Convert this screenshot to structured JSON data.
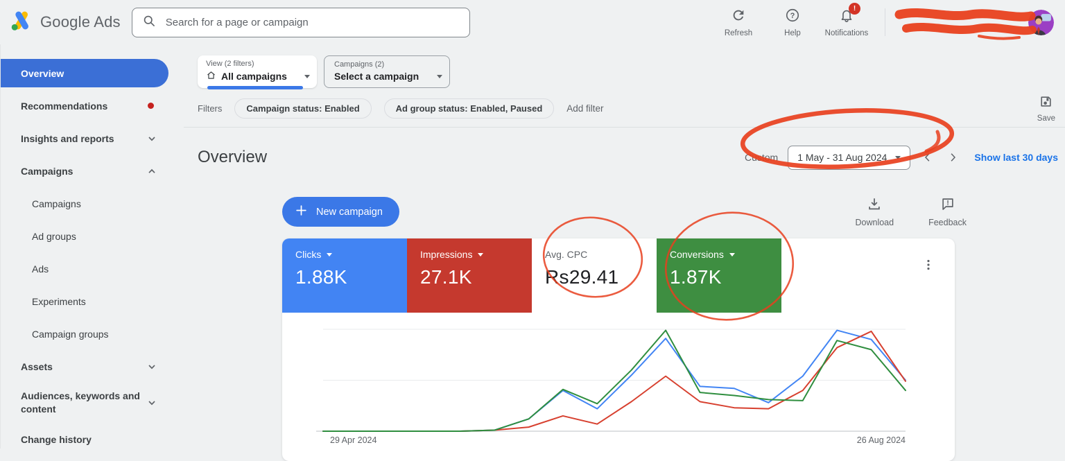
{
  "topbar": {
    "brand": "Google Ads",
    "search": {
      "placeholder": "Search for a page or campaign"
    },
    "refresh_label": "Refresh",
    "help_label": "Help",
    "notifications_label": "Notifications",
    "notification_badge": "!"
  },
  "sidebar": {
    "items": [
      {
        "label": "Overview",
        "selected": true
      },
      {
        "label": "Recommendations",
        "alert_dot": true
      },
      {
        "label": "Insights and reports",
        "chevron": "down"
      },
      {
        "label": "Campaigns",
        "chevron": "up",
        "expanded": true
      },
      {
        "label": "Campaigns",
        "indent": true
      },
      {
        "label": "Ad groups",
        "indent": true
      },
      {
        "label": "Ads",
        "indent": true
      },
      {
        "label": "Experiments",
        "indent": true
      },
      {
        "label": "Campaign groups",
        "indent": true
      },
      {
        "label": "Assets",
        "chevron": "down"
      },
      {
        "label": "Audiences, keywords and content",
        "chevron": "down"
      },
      {
        "label": "Change history"
      }
    ]
  },
  "toolbar": {
    "view_selector": {
      "label": "View (2 filters)",
      "value": "All campaigns"
    },
    "campaign_selector": {
      "label": "Campaigns (2)",
      "value": "Select a campaign"
    },
    "filters_label": "Filters",
    "filter_chips": [
      "Campaign status: Enabled",
      "Ad group status: Enabled, Paused"
    ],
    "add_filter_label": "Add filter",
    "save_label": "Save"
  },
  "page_header": {
    "title": "Overview",
    "date_mode": "Custom",
    "date_range": "1 May - 31 Aug 2024",
    "quick_range_link": "Show last 30 days"
  },
  "actions_row": {
    "new_campaign_label": "New campaign",
    "download_label": "Download",
    "feedback_label": "Feedback"
  },
  "scorecards": [
    {
      "metric": "Clicks",
      "value": "1.88K",
      "color": "#4284f3",
      "text_color": "#ffffff",
      "has_caret": true
    },
    {
      "metric": "Impressions",
      "value": "27.1K",
      "color": "#c5392e",
      "text_color": "#ffffff",
      "has_caret": true
    },
    {
      "metric": "Avg. CPC",
      "value": "Rs29.41",
      "color": "#ffffff",
      "text_color": "#202124",
      "has_caret": false
    },
    {
      "metric": "Conversions",
      "value": "1.87K",
      "color": "#3e8e41",
      "text_color": "#ffffff",
      "has_caret": true
    }
  ],
  "chart_data": {
    "type": "line",
    "title": "",
    "xlabel": "",
    "ylabel": "",
    "x": [
      "29 Apr 2024",
      "6 May",
      "13 May",
      "20 May",
      "27 May",
      "3 Jun",
      "10 Jun",
      "17 Jun",
      "24 Jun",
      "1 Jul",
      "8 Jul",
      "15 Jul",
      "22 Jul",
      "29 Jul",
      "5 Aug",
      "12 Aug",
      "19 Aug",
      "26 Aug 2024"
    ],
    "visible_x_labels": [
      "29 Apr 2024",
      "26 Aug 2024"
    ],
    "y_axis_note": "no y tick labels shown; values are relative 0-100, each series normalized to its own peak",
    "ylim": [
      0,
      100
    ],
    "legend": "none (series colors match scorecards)",
    "gridlines": {
      "horizontal_at": [
        0,
        50,
        100
      ],
      "color": "#e9ebec",
      "baseline_color": "#d3d6d9"
    },
    "series": [
      {
        "name": "Clicks",
        "color": "#4285f4",
        "values": [
          0,
          0,
          0,
          0,
          0,
          1,
          12,
          40,
          22,
          55,
          91,
          44,
          42,
          28,
          54,
          99,
          90,
          50
        ]
      },
      {
        "name": "Impressions",
        "color": "#d7402f",
        "values": [
          0,
          0,
          0,
          0,
          0,
          1,
          4,
          15,
          7,
          29,
          54,
          29,
          23,
          22,
          40,
          82,
          98,
          49
        ]
      },
      {
        "name": "Conversions",
        "color": "#2f8e3f",
        "values": [
          0,
          0,
          0,
          0,
          0,
          1,
          12,
          41,
          27,
          60,
          99,
          38,
          35,
          31,
          30,
          89,
          80,
          40
        ]
      }
    ]
  },
  "annotations": {
    "marker_color": "#e8401e",
    "marks": [
      "hand-drawn ellipse around date range picker",
      "hand-drawn ellipse around Avg. CPC scorecard",
      "hand-drawn ellipse around Conversions scorecard",
      "scribble hiding account name (top right)",
      "scribble hiding account email (top right)"
    ]
  },
  "icons": {
    "google-ads-logo": "yellow and blue angled bars with green dot",
    "search-icon": "magnifying glass",
    "refresh-icon": "circular arrow",
    "help-icon": "question mark in circle",
    "bell-icon": "notification bell",
    "home-icon": "house outline",
    "save-icon": "floppy disk",
    "plus-icon": "plus sign",
    "download-icon": "down arrow into tray",
    "feedback-icon": "speech bubble with exclamation",
    "kebab-icon": "three vertical dots",
    "caret-down-icon": "small filled down triangle",
    "chevron-left-icon": "angle bracket left",
    "chevron-right-icon": "angle bracket right",
    "avatar": "purple cartoon profile photo"
  }
}
